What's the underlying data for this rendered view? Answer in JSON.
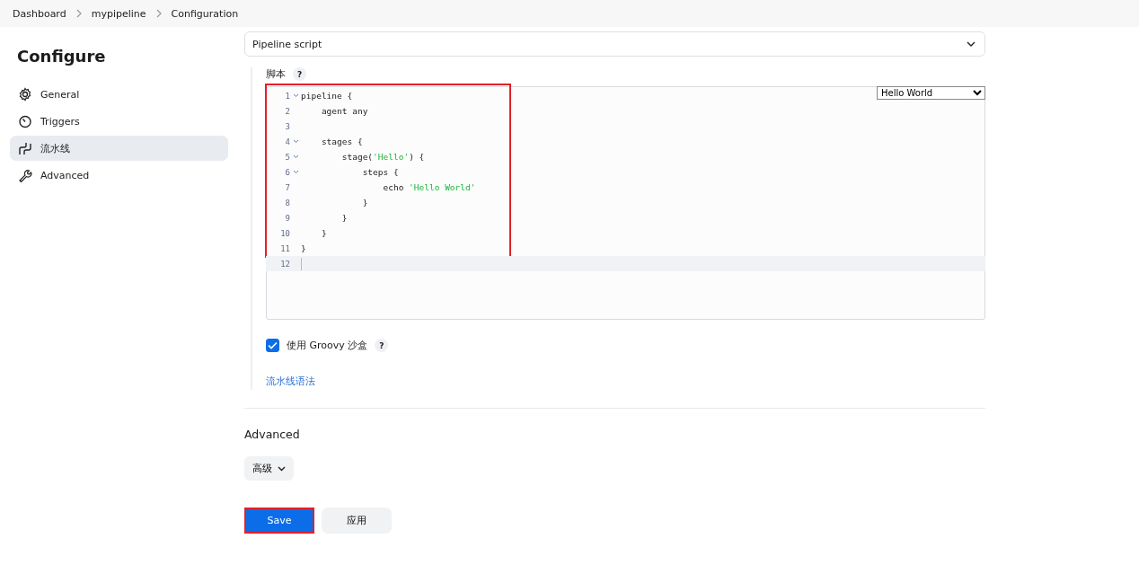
{
  "breadcrumbs": [
    {
      "label": "Dashboard"
    },
    {
      "label": "mypipeline"
    },
    {
      "label": "Configuration"
    }
  ],
  "sidebar": {
    "title": "Configure",
    "items": [
      {
        "label": "General",
        "selected": false
      },
      {
        "label": "Triggers",
        "selected": false
      },
      {
        "label": "流水线",
        "selected": true
      },
      {
        "label": "Advanced",
        "selected": false
      }
    ]
  },
  "definition": {
    "value": "Pipeline script"
  },
  "script": {
    "label": "脚本",
    "help": "?",
    "sample": "Hello World",
    "lines": [
      {
        "number": "1",
        "foldable": true,
        "parts": [
          {
            "kind": "plain",
            "text": "pipeline {"
          }
        ]
      },
      {
        "number": "2",
        "foldable": false,
        "parts": [
          {
            "kind": "plain",
            "text": "    agent any"
          }
        ]
      },
      {
        "number": "3",
        "foldable": false
      },
      {
        "number": "4",
        "foldable": true,
        "parts": [
          {
            "kind": "plain",
            "text": "    stages {"
          }
        ]
      },
      {
        "number": "5",
        "foldable": true,
        "parts": [
          {
            "kind": "plain",
            "text": "        stage("
          },
          {
            "kind": "string",
            "text": "'Hello'"
          },
          {
            "kind": "plain",
            "text": ") {"
          }
        ]
      },
      {
        "number": "6",
        "foldable": true,
        "parts": [
          {
            "kind": "plain",
            "text": "            steps {"
          }
        ]
      },
      {
        "number": "7",
        "foldable": false,
        "parts": [
          {
            "kind": "plain",
            "text": "                echo "
          },
          {
            "kind": "string",
            "text": "'Hello World'"
          }
        ]
      },
      {
        "number": "8",
        "foldable": false,
        "parts": [
          {
            "kind": "plain",
            "text": "            }"
          }
        ]
      },
      {
        "number": "9",
        "foldable": false,
        "parts": [
          {
            "kind": "plain",
            "text": "        }"
          }
        ]
      },
      {
        "number": "10",
        "foldable": false,
        "parts": [
          {
            "kind": "plain",
            "text": "    }"
          }
        ]
      },
      {
        "number": "11",
        "foldable": false,
        "parts": [
          {
            "kind": "plain",
            "text": "}"
          }
        ]
      },
      {
        "number": "12",
        "foldable": false
      }
    ]
  },
  "sandbox": {
    "label": "使用 Groovy 沙盒",
    "checked": true,
    "help": "?"
  },
  "syntax_link": "流水线语法",
  "advanced": {
    "heading": "Advanced",
    "button": "高级"
  },
  "buttons": {
    "save": "Save",
    "apply": "应用"
  }
}
